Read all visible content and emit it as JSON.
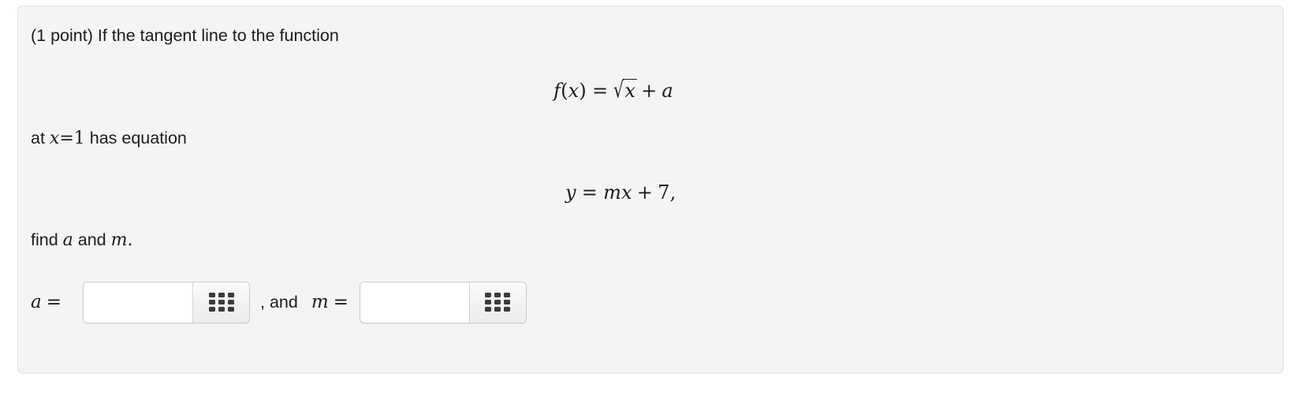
{
  "problem": {
    "points_label": "(1 point) If the tangent line to the function",
    "equation_f": {
      "lhs": "f",
      "lparen": "(",
      "arg": "x",
      "rparen": ")",
      "relation": "=",
      "radical_sign": "√",
      "radicand": "x",
      "operator": "+",
      "constant_term": "a"
    },
    "line_at": {
      "prefix": "at ",
      "var": "x",
      "relation": "=",
      "value": "1",
      "suffix": " has equation"
    },
    "equation_y": {
      "lhs": "y",
      "relation": "=",
      "slope": "m",
      "var": "x",
      "operator": "+",
      "intercept": "7",
      "trailing": ","
    },
    "line_find": {
      "prefix": "find ",
      "first_unknown": "a",
      "conjunction": " and ",
      "second_unknown": "m",
      "period": "."
    }
  },
  "answers": {
    "first": {
      "label_var": "a",
      "label_eq": "=",
      "value": "",
      "placeholder": "",
      "keypad_icon": "keypad-grid-icon"
    },
    "separator": ", and ",
    "second": {
      "label_var": "m",
      "label_eq": "=",
      "value": "",
      "placeholder": "",
      "keypad_icon": "keypad-grid-icon"
    }
  },
  "colors": {
    "panel_background": "#f4f4f4",
    "panel_border": "#e2e2e2",
    "page_background": "#ffffff",
    "text": "#1c1c1c",
    "input_background": "#ffffff",
    "input_border": "#cbcbcb",
    "keypad_dot": "#3b3b3b"
  }
}
